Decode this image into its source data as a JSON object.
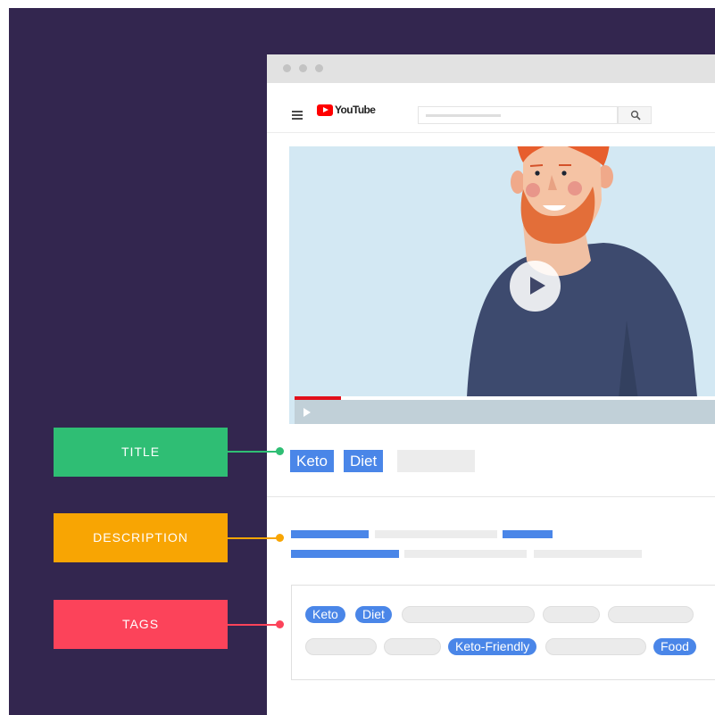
{
  "colors": {
    "frame_bg": "#33264f",
    "title_label": "#2fbe74",
    "description_label": "#f8a503",
    "tags_label": "#fc435a",
    "highlight_blue": "#4a86e8",
    "youtube_red": "#ff0000"
  },
  "browser": {
    "window_dots": [
      "window-dot",
      "window-dot",
      "window-dot"
    ],
    "menu_icon": "hamburger-menu-icon",
    "logo_text": "YouTube",
    "search_icon": "search-icon"
  },
  "video": {
    "play_icon": "play-icon",
    "progress_fraction": 0.11
  },
  "labels": {
    "title": "TITLE",
    "description": "DESCRIPTION",
    "tags": "TAGS"
  },
  "title_words": [
    "Keto",
    "Diet"
  ],
  "tags": {
    "row1": [
      "Keto",
      "Diet"
    ],
    "row2": [
      "Keto-Friendly",
      "Food"
    ]
  }
}
